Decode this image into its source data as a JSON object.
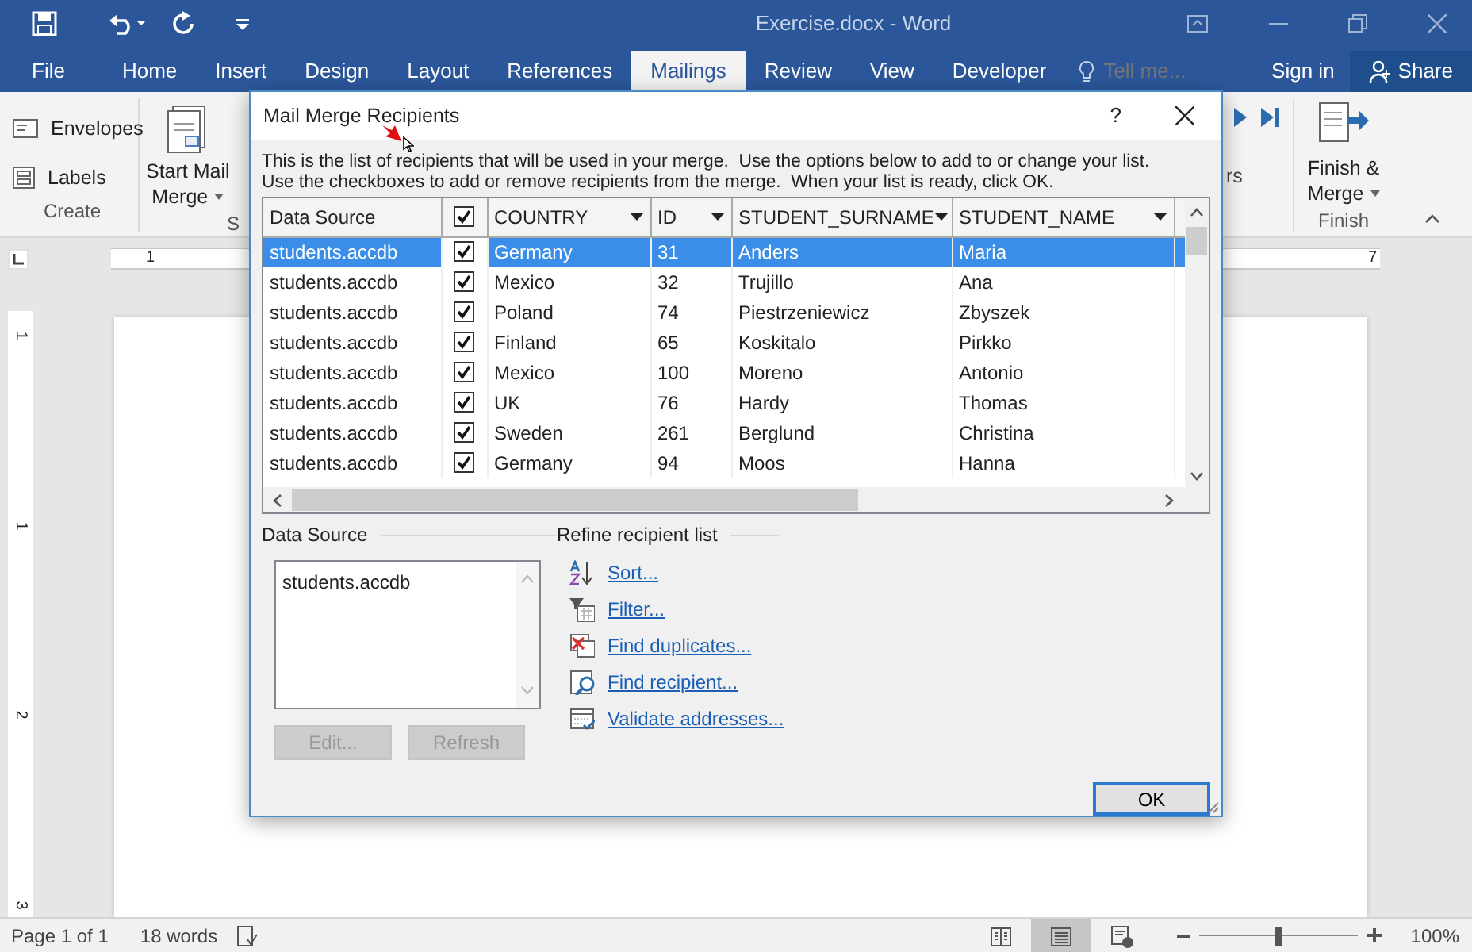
{
  "window": {
    "title": "Exercise.docx - Word"
  },
  "ribbon_tabs": [
    {
      "label": "File",
      "selected": false
    },
    {
      "label": "Home",
      "selected": false
    },
    {
      "label": "Insert",
      "selected": false
    },
    {
      "label": "Design",
      "selected": false
    },
    {
      "label": "Layout",
      "selected": false
    },
    {
      "label": "References",
      "selected": false
    },
    {
      "label": "Mailings",
      "selected": true
    },
    {
      "label": "Review",
      "selected": false
    },
    {
      "label": "View",
      "selected": false
    },
    {
      "label": "Developer",
      "selected": false
    }
  ],
  "tell_me": {
    "placeholder": "Tell me..."
  },
  "account": {
    "sign_in": "Sign in",
    "share": "Share"
  },
  "ribbon": {
    "create": {
      "label": "Create",
      "buttons": [
        "Envelopes",
        "Labels"
      ]
    },
    "start": {
      "label": "S",
      "line1": "Start Mail",
      "line2": "Merge"
    },
    "hidden_fragment": "rs",
    "finish": {
      "label": "Finish",
      "line1": "Finish &",
      "line2": "Merge"
    }
  },
  "ruler": {
    "horizontal": [
      "1",
      "7"
    ],
    "vertical": [
      "1",
      "1",
      "2",
      "3"
    ]
  },
  "dialog": {
    "title": "Mail Merge Recipients",
    "help": "?",
    "instructions": [
      "This is the list of recipients that will be used in your merge.  Use the options below to add to or change your list.",
      "Use the checkboxes to add or remove recipients from the merge.  When your list is ready, click OK."
    ],
    "table": {
      "select_all": {
        "checked": true
      },
      "columns": [
        {
          "label": "Data Source",
          "dropdown": false
        },
        {
          "label": "COUNTRY",
          "dropdown": true
        },
        {
          "label": "ID",
          "dropdown": true
        },
        {
          "label": "STUDENT_SURNAME",
          "dropdown": true
        },
        {
          "label": "STUDENT_NAME",
          "dropdown": true
        }
      ],
      "rows": [
        {
          "selected": true,
          "checked": true,
          "cells": [
            "students.accdb",
            "Germany",
            "31",
            "Anders",
            "Maria"
          ]
        },
        {
          "selected": false,
          "checked": true,
          "cells": [
            "students.accdb",
            "Mexico",
            "32",
            "Trujillo",
            "Ana"
          ]
        },
        {
          "selected": false,
          "checked": true,
          "cells": [
            "students.accdb",
            "Poland",
            "74",
            "Piestrzeniewicz",
            "Zbyszek"
          ]
        },
        {
          "selected": false,
          "checked": true,
          "cells": [
            "students.accdb",
            "Finland",
            "65",
            "Koskitalo",
            "Pirkko"
          ]
        },
        {
          "selected": false,
          "checked": true,
          "cells": [
            "students.accdb",
            "Mexico",
            "100",
            "Moreno",
            "Antonio"
          ]
        },
        {
          "selected": false,
          "checked": true,
          "cells": [
            "students.accdb",
            "UK",
            "76",
            "Hardy",
            "Thomas"
          ]
        },
        {
          "selected": false,
          "checked": true,
          "cells": [
            "students.accdb",
            "Sweden",
            "261",
            "Berglund",
            "Christina"
          ]
        },
        {
          "selected": false,
          "checked": true,
          "cells": [
            "students.accdb",
            "Germany",
            "94",
            "Moos",
            "Hanna"
          ]
        }
      ]
    },
    "data_source": {
      "label": "Data Source",
      "items": [
        "students.accdb"
      ],
      "buttons": [
        {
          "label": "Edit...",
          "disabled": true
        },
        {
          "label": "Refresh",
          "disabled": true
        }
      ]
    },
    "refine": {
      "label": "Refine recipient list",
      "links": [
        {
          "kind": "sort",
          "label": "Sort..."
        },
        {
          "kind": "filter",
          "label": "Filter..."
        },
        {
          "kind": "duplicates",
          "label": "Find duplicates..."
        },
        {
          "kind": "find",
          "label": "Find recipient..."
        },
        {
          "kind": "validate",
          "label": "Validate addresses..."
        }
      ]
    },
    "ok": "OK"
  },
  "status_bar": {
    "page": "Page 1 of 1",
    "words": "18 words",
    "views": [
      {
        "kind": "read",
        "selected": false
      },
      {
        "kind": "print",
        "selected": true
      },
      {
        "kind": "web",
        "selected": false
      }
    ],
    "zoom": {
      "level": 0.5,
      "reading": "100%"
    }
  }
}
